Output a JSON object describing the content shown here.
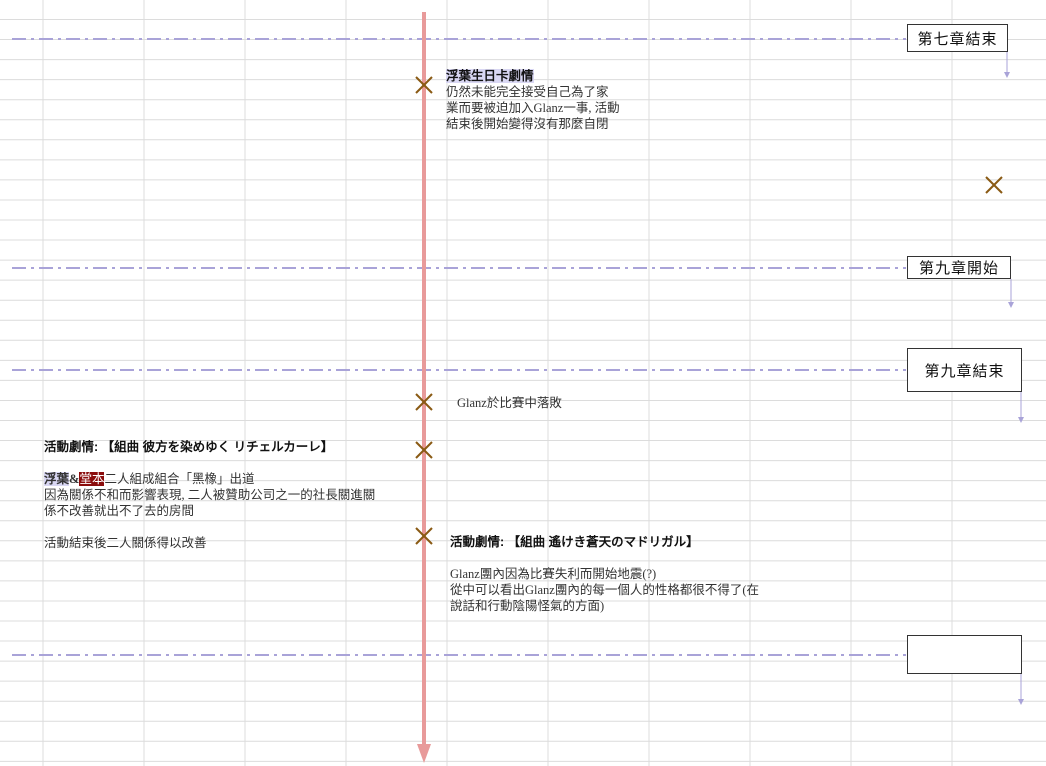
{
  "colors": {
    "grid": "#dcdcdc",
    "dash_line": "#a9a3d8",
    "main_arrow": "#e89a9a",
    "cross": "#8a5a14",
    "small_arrow": "#a9a3d8"
  },
  "chapters": [
    {
      "id": "ch7_end",
      "label": "第七章結束"
    },
    {
      "id": "ch9_start",
      "label": "第九章開始"
    },
    {
      "id": "ch9_end",
      "label": "第九章結束"
    },
    {
      "id": "empty",
      "label": ""
    }
  ],
  "notes": {
    "birthday": {
      "title": "浮葉生日卡劇情",
      "lines": [
        "仍然未能完全接受自己為了家",
        "業而要被迫加入Glanz一事, 活動",
        "結束後開始變得沒有那麼自閉"
      ]
    },
    "defeat": {
      "text": "Glanz於比賽中落敗"
    },
    "event1": {
      "title": "活動劇情: 【組曲 彼方を染めゆく リチェルカーレ】",
      "line1_name1": "浮葉",
      "line1_amp": "&",
      "line1_name2": "堂本",
      "line1_rest": "二人組成組合「黑橡」出道",
      "lines": [
        "因為關係不和而影響表現, 二人被贊助公司之一的社長關進關",
        "係不改善就出不了去的房間"
      ],
      "ending": "活動結束後二人關係得以改善"
    },
    "event2": {
      "title": "活動劇情: 【組曲 遙けき蒼天のマドリガル】",
      "lines": [
        "Glanz團內因為比賽失利而開始地震(?)",
        "從中可以看出Glanz團內的每一個人的性格都很不得了(在",
        "說話和行動陰陽怪氣的方面)"
      ]
    }
  }
}
